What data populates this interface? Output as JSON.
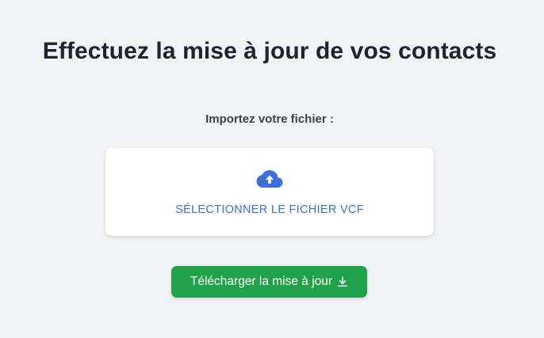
{
  "page": {
    "title": "Effectuez la mise à jour de vos contacts",
    "import_label": "Importez votre fichier :"
  },
  "dropzone": {
    "icon": "cloud-upload-icon",
    "label": "SÉLECTIONNER LE FICHIER VCF"
  },
  "download_button": {
    "label": "Télécharger la mise à jour",
    "icon": "download-icon"
  },
  "colors": {
    "background": "#f2f3f5",
    "accent_blue": "#3d6fd8",
    "button_green": "#1fa24a"
  }
}
